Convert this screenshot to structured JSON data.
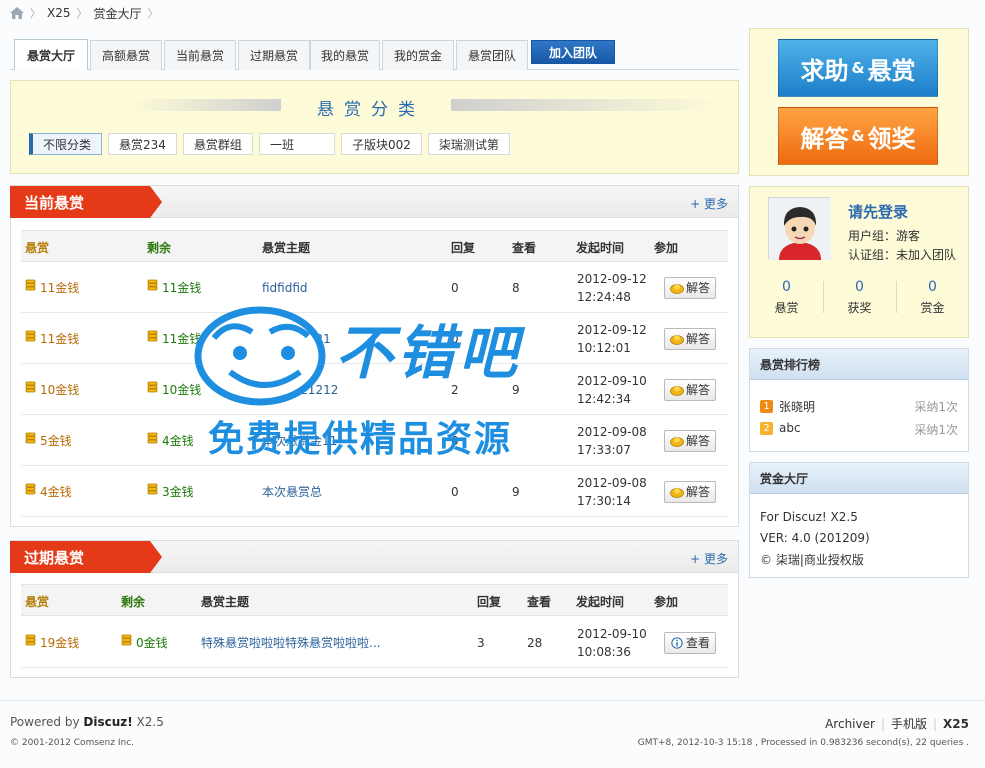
{
  "breadcrumb": {
    "items": [
      "X25",
      "赏金大厅"
    ]
  },
  "tabs": [
    {
      "label": "悬赏大厅",
      "active": true
    },
    {
      "label": "高额悬赏"
    },
    {
      "label": "当前悬赏"
    },
    {
      "label": "过期悬赏"
    },
    {
      "label": "我的悬赏"
    },
    {
      "label": "我的赏金"
    },
    {
      "label": "悬赏团队"
    },
    {
      "label": "加入团队"
    }
  ],
  "categories": {
    "title": "悬赏分类",
    "items": [
      "不限分类",
      "悬赏234",
      "悬赏群组",
      "一班",
      "子版块002",
      "柒瑞测试第"
    ]
  },
  "current": {
    "title": "当前悬赏",
    "more": "+ 更多",
    "headers": [
      "悬赏",
      "剩余",
      "悬赏主题",
      "回复",
      "查看",
      "发起时间",
      "参加"
    ],
    "rows": [
      {
        "reward": "11金钱",
        "left": "11金钱",
        "topic": "fidfidfid",
        "replies": "0",
        "views": "8",
        "date": "2012-09-12",
        "time": "12:24:48",
        "action": "解答"
      },
      {
        "reward": "11金钱",
        "left": "11金钱",
        "topic": "121212121",
        "replies": "0",
        "views": "",
        "date": "2012-09-12",
        "time": "10:12:01",
        "action": "解答"
      },
      {
        "reward": "10金钱",
        "left": "10金钱",
        "topic": "1212121212",
        "replies": "2",
        "views": "9",
        "date": "2012-09-10",
        "time": "12:42:34",
        "action": "解答"
      },
      {
        "reward": "5金钱",
        "left": "4金钱",
        "topic": "本次悬赏金11",
        "replies": "0",
        "views": "",
        "date": "2012-09-08",
        "time": "17:33:07",
        "action": "解答"
      },
      {
        "reward": "4金钱",
        "left": "3金钱",
        "topic": "本次悬赏总",
        "replies": "0",
        "views": "9",
        "date": "2012-09-08",
        "time": "17:30:14",
        "action": "解答"
      }
    ]
  },
  "expired": {
    "title": "过期悬赏",
    "more": "+ 更多",
    "headers": [
      "悬赏",
      "剩余",
      "悬赏主题",
      "回复",
      "查看",
      "发起时间",
      "参加"
    ],
    "rows": [
      {
        "reward": "19金钱",
        "left": "0金钱",
        "topic": "特殊悬赏啦啦啦特殊悬赏啦啦啦...",
        "replies": "3",
        "views": "28",
        "date": "2012-09-10",
        "time": "10:08:36",
        "action": "查看"
      }
    ]
  },
  "sidebar": {
    "ask": {
      "part1": "求助",
      "amp": "&",
      "part2": "悬赏"
    },
    "answer": {
      "part1": "解答",
      "amp": "&",
      "part2": "领奖"
    },
    "login": {
      "title": "请先登录",
      "group": "用户组：游客",
      "auth": "认证组：未加入团队",
      "stats": [
        {
          "n": "0",
          "label": "悬赏"
        },
        {
          "n": "0",
          "label": "获奖"
        },
        {
          "n": "0",
          "label": "赏金"
        }
      ]
    },
    "ranking": {
      "title": "悬赏排行榜",
      "items": [
        {
          "num": "1",
          "name": "张晓明",
          "count": "采纳1次"
        },
        {
          "num": "2",
          "name": "abc",
          "count": "采纳1次"
        }
      ]
    },
    "about": {
      "title": "赏金大厅",
      "lines": [
        "For Discuz! X2.5",
        "VER: 4.0 (201209)",
        "© 柒瑞|商业授权版"
      ]
    }
  },
  "watermark": {
    "line1": "不错吧",
    "line2": "免费提供精品资源"
  },
  "footer": {
    "powered_prefix": "Powered by ",
    "powered_brand": "Discuz!",
    "powered_ver": " X2.5",
    "copyright": "© 2001-2012 Comsenz Inc.",
    "links": [
      "Archiver",
      "手机版",
      "X25"
    ],
    "stats": "GMT+8, 2012-10-3 15:18 , Processed in 0.983236 second(s), 22 queries ."
  },
  "colors": {
    "accent": "#2a6bb0",
    "ribbon": "#e43a17",
    "yellow_bg": "#fdfbd8"
  }
}
